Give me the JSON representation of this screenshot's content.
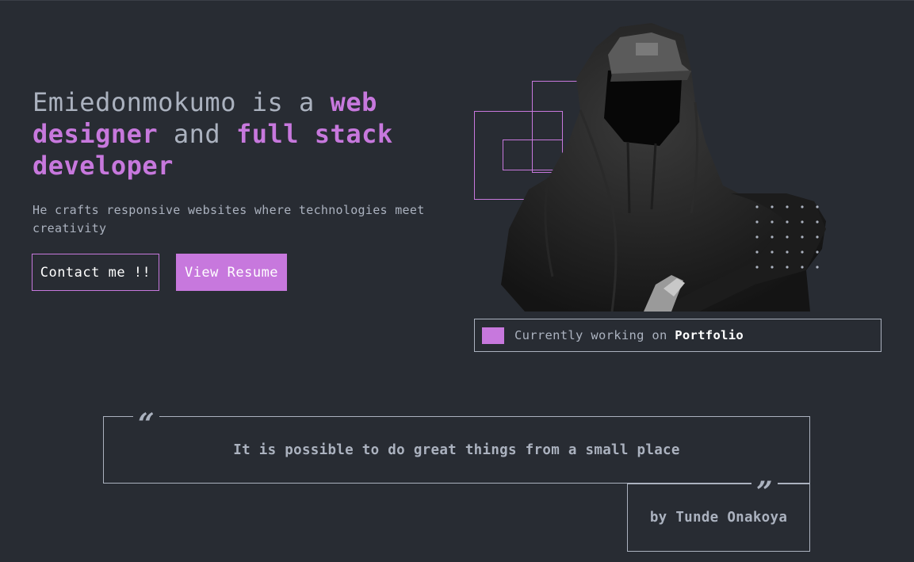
{
  "hero": {
    "title_part1": "Emiedonmokumo is a ",
    "title_accent1": "web designer",
    "title_part2": " and ",
    "title_accent2": "full stack developer",
    "subtitle": "He crafts responsive websites where technologies meet creativity",
    "contact_button": "Contact me !!",
    "resume_button": "View Resume"
  },
  "status": {
    "prefix": "Currently working on ",
    "project": "Portfolio"
  },
  "quote": {
    "text": "It is possible to do great things from a small place",
    "author": "by Tunde Onakoya",
    "open_mark": "“",
    "close_mark": "”"
  },
  "colors": {
    "background": "#282c33",
    "accent": "#c778dd",
    "text": "#abb2bf",
    "white": "#ffffff"
  },
  "icons": {
    "quote_open": "open-quote-icon",
    "quote_close": "close-quote-icon",
    "status_indicator": "status-square-icon"
  }
}
